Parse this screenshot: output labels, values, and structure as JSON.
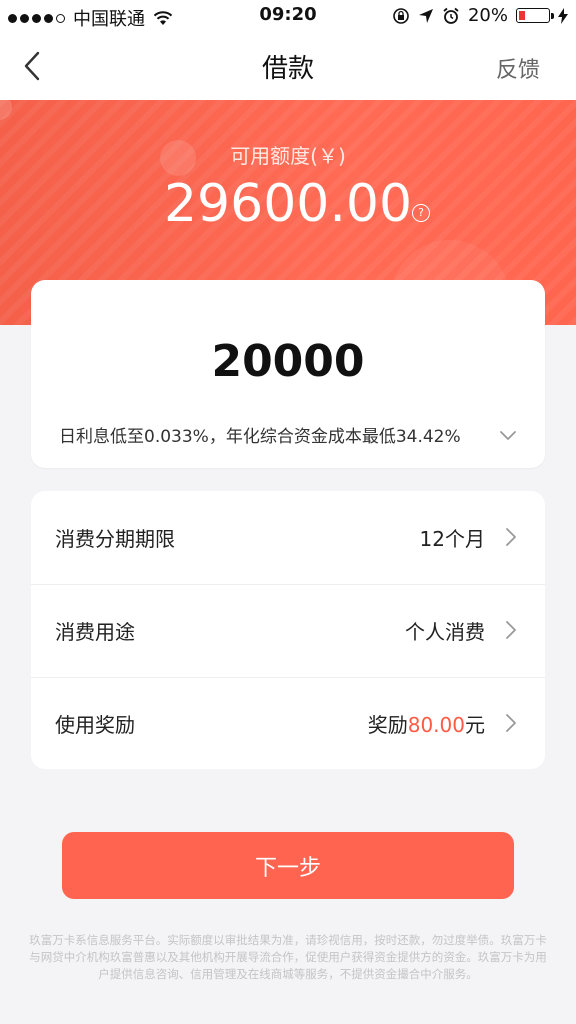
{
  "status_bar": {
    "carrier": "中国联通",
    "time": "09:20",
    "battery": "20%"
  },
  "nav": {
    "title": "借款",
    "right_action": "反馈"
  },
  "hero": {
    "label": "可用额度(￥)",
    "amount": "29600.00",
    "help_glyph": "?"
  },
  "loan": {
    "amount": "20000",
    "rate_text": "日利息低至0.033%，年化综合资金成本最低34.42%"
  },
  "options": [
    {
      "label": "消费分期期限",
      "value": "12个月"
    },
    {
      "label": "消费用途",
      "value": "个人消费"
    },
    {
      "label": "使用奖励",
      "value_prefix": "奖励",
      "value_accent": "80.00",
      "value_suffix": "元"
    }
  ],
  "next_button": "下一步",
  "footer": "玖富万卡系信息服务平台。实际额度以审批结果为准，请珍视信用，按时还款，勿过度举债。玖富万卡与网贷中介机构玖富普惠以及其他机构开展导流合作，促使用户获得资金提供方的资金。玖富万卡为用户提供信息咨询、信用管理及在线商城等服务，不提供资金撮合中介服务。",
  "colors": {
    "brand": "#ff6450",
    "accent": "#ff5a45"
  }
}
